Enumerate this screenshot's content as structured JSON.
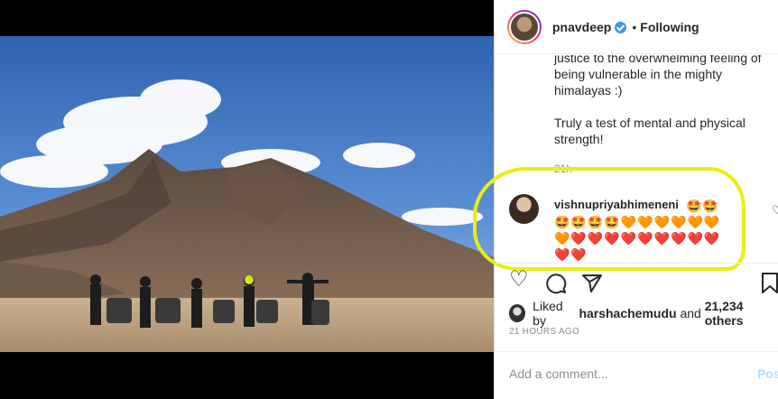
{
  "post": {
    "username": "pnavdeep",
    "follow_state": "Following",
    "dot": "•",
    "caption_lines": [
      "justice to the overwhelming feeling of being vulnerable in the mighty himalayas :)",
      "Truly a test of mental and physical strength!"
    ],
    "caption_age": "21h"
  },
  "comment": {
    "username": "vishnupriyabhimeneni",
    "text": "🤩🤩🤩🤩🤩🤩🧡🧡🧡🧡🧡🧡🧡❤️❤️❤️❤️❤️❤️❤️❤️❤️❤️❤️",
    "like_icon": "heart-outline-icon"
  },
  "actions": {
    "like": "heart-outline-icon",
    "comment": "comment-bubble-icon",
    "share": "paper-plane-icon",
    "save": "bookmark-icon"
  },
  "likes": {
    "prefix": "Liked by",
    "user": "harshachemudu",
    "middle": "and",
    "others": "21,234 others"
  },
  "posted_time": "21 HOURS AGO",
  "add_comment": {
    "placeholder": "Add a comment...",
    "post_label": "Post"
  },
  "colors": {
    "highlight": "#e9ee15",
    "verified": "#3897f0",
    "post_button": "#b2dffc"
  }
}
